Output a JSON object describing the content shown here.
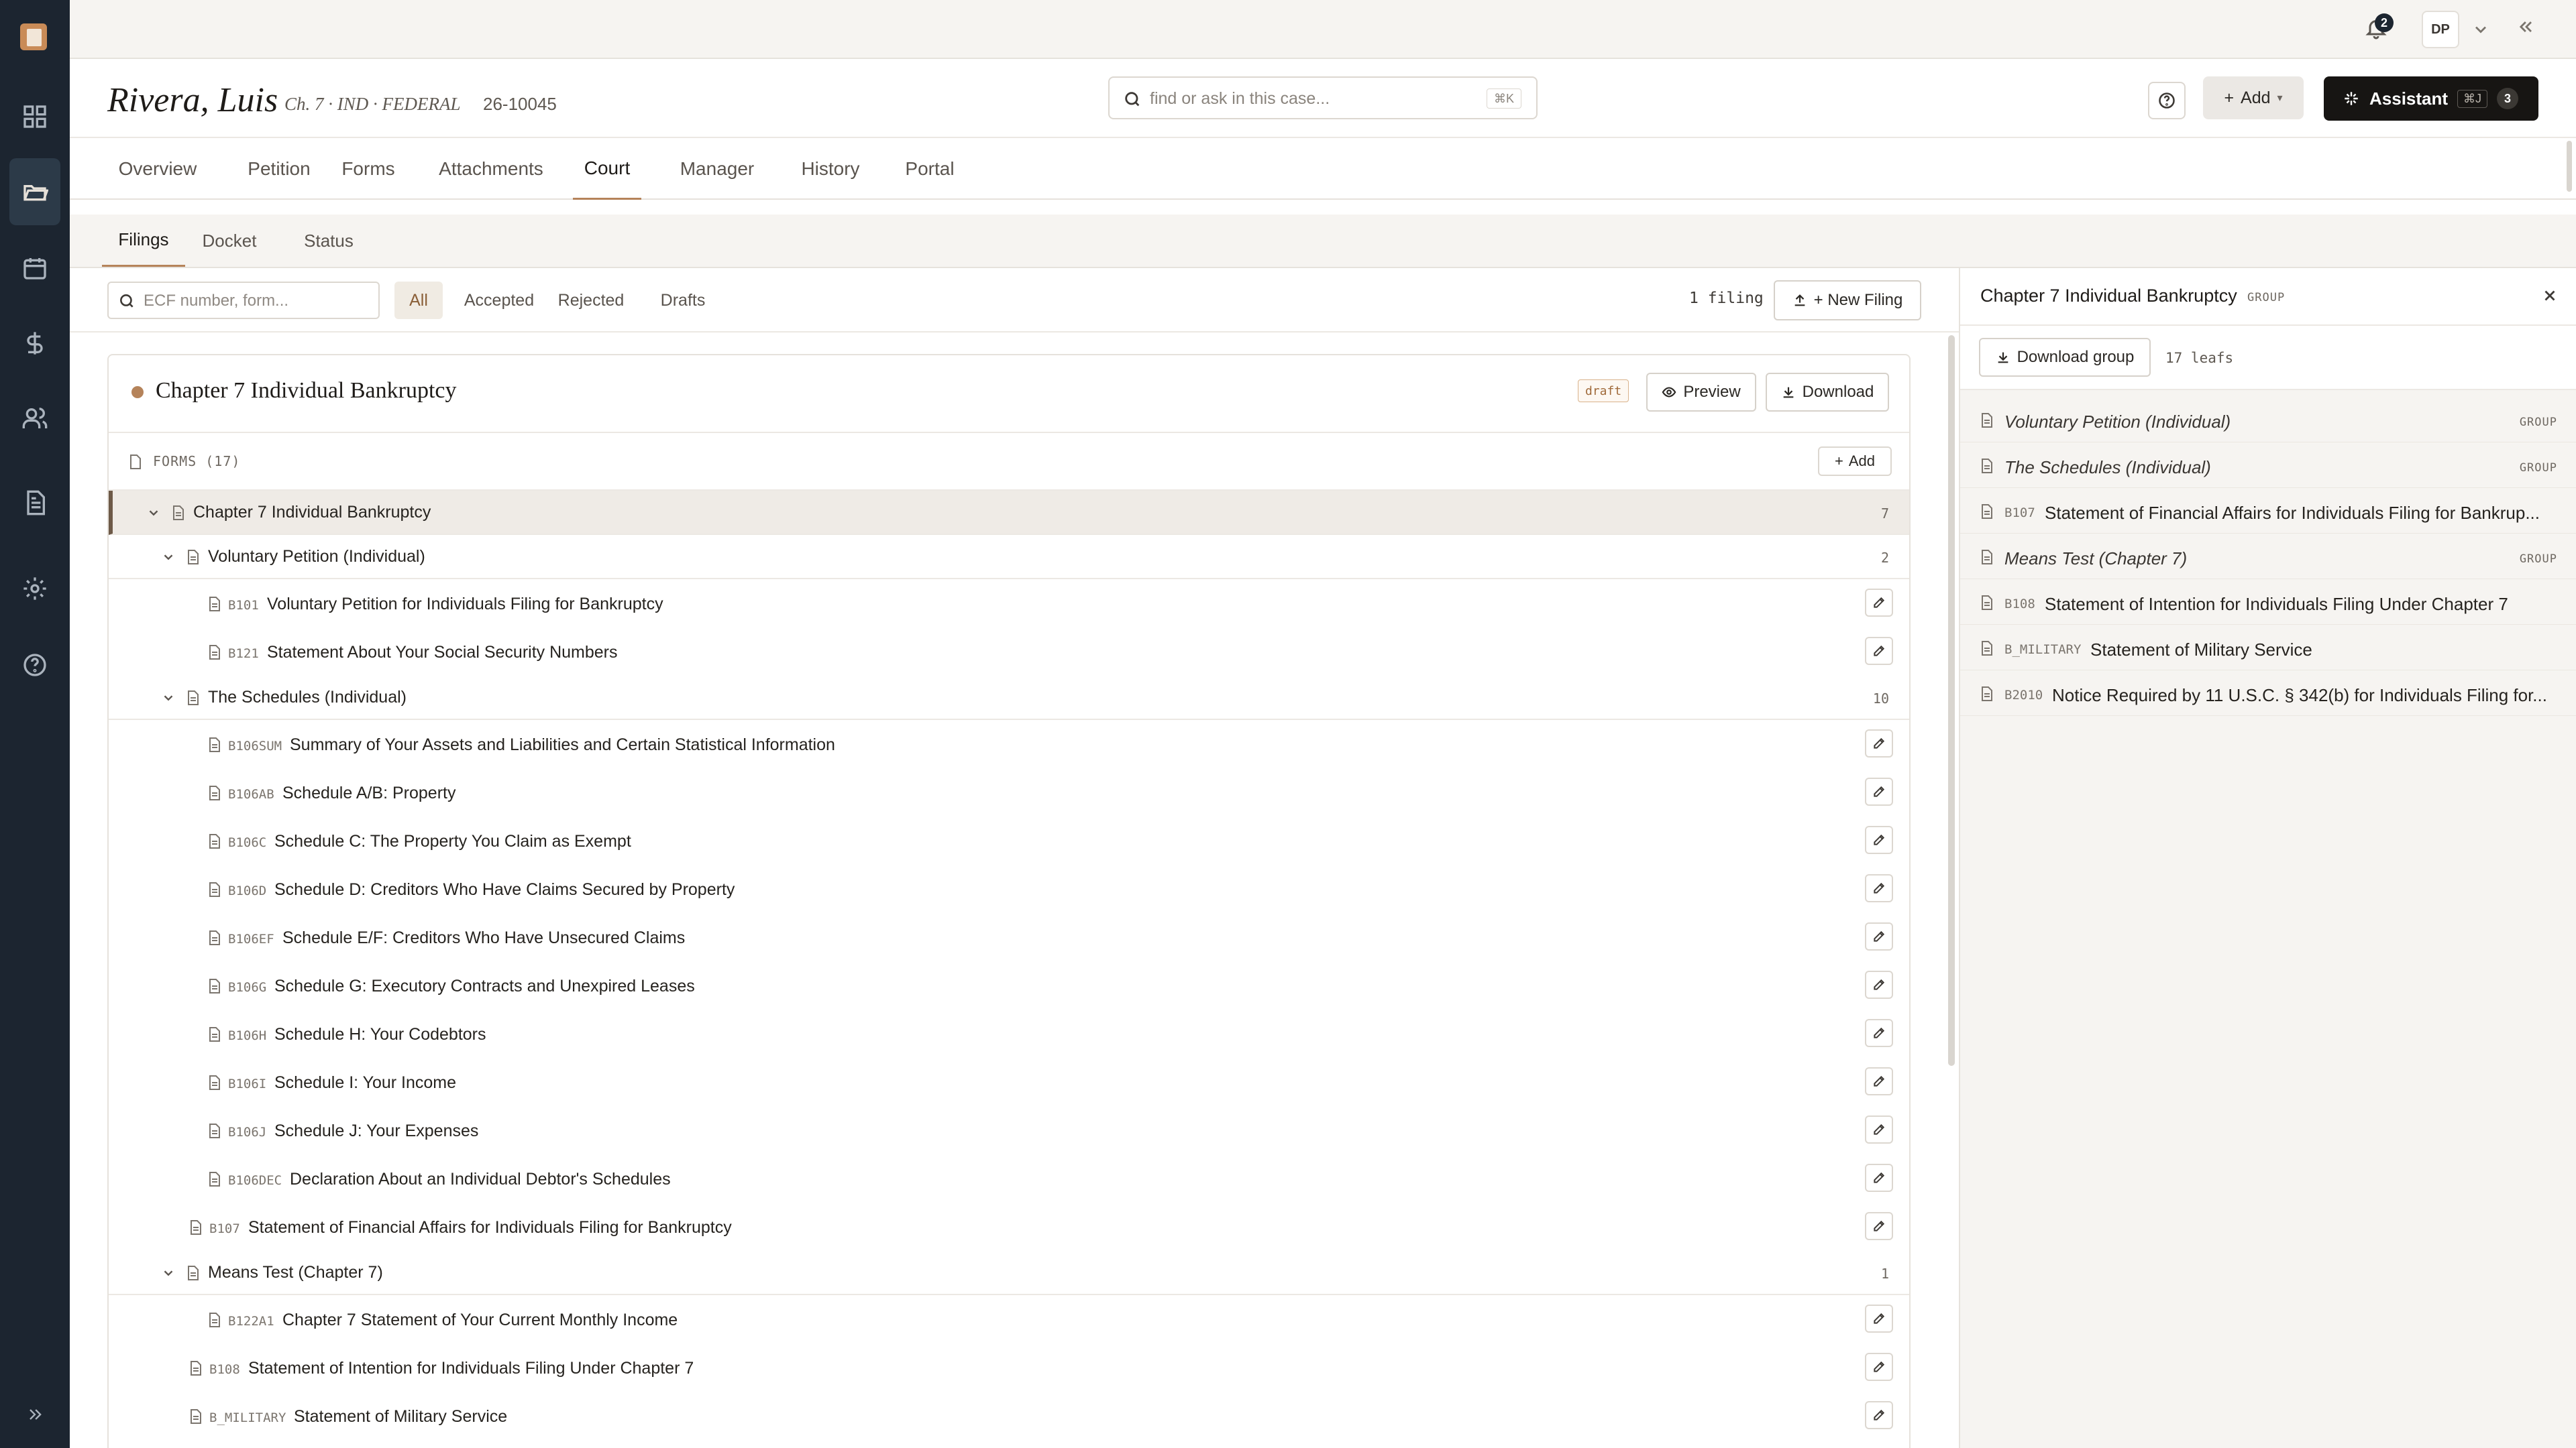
{
  "rail": {
    "items": [
      "dashboard-icon",
      "folder-icon",
      "calendar-icon",
      "dollar-icon",
      "users-icon",
      "document-icon",
      "gear-icon",
      "help-icon"
    ],
    "active": "folder-icon",
    "expand_icon": "chevrons-right-icon"
  },
  "topbar": {
    "notification_count": "2",
    "user_initials": "DP"
  },
  "case": {
    "name": "Rivera, Luis",
    "meta": "Ch. 7 · IND · FEDERAL",
    "case_number": "26-10045",
    "search_placeholder": "find or ask in this case...",
    "search_shortcut": "⌘K",
    "add_label": "Add",
    "assistant_label": "Assistant",
    "assistant_shortcut": "⌘J",
    "assistant_count": "3"
  },
  "main_tabs": [
    "Overview",
    "Petition",
    "Forms",
    "Attachments",
    "Court",
    "Manager",
    "History",
    "Portal"
  ],
  "main_tab_active": "Court",
  "sub_tabs": [
    "Filings",
    "Docket",
    "Status"
  ],
  "sub_tab_active": "Filings",
  "filters": {
    "search_placeholder": "ECF number, form...",
    "pills": [
      "All",
      "Accepted",
      "Rejected",
      "Drafts"
    ],
    "active": "All",
    "count_label": "1 filing",
    "new_filing_label": "+ New Filing"
  },
  "filing": {
    "title": "Chapter 7 Individual Bankruptcy",
    "status": "draft",
    "preview_label": "Preview",
    "download_label": "Download",
    "forms_label": "FORMS (17)",
    "add_label": "Add",
    "tree": [
      {
        "kind": "root",
        "title": "Chapter 7 Individual Bankruptcy",
        "count": "7"
      },
      {
        "kind": "group",
        "title": "Voluntary Petition (Individual)",
        "count": "2"
      },
      {
        "kind": "leaf",
        "depth": 2,
        "code": "B101",
        "title": "Voluntary Petition for Individuals Filing for Bankruptcy"
      },
      {
        "kind": "leaf",
        "depth": 2,
        "code": "B121",
        "title": "Statement About Your Social Security Numbers"
      },
      {
        "kind": "group",
        "title": "The Schedules (Individual)",
        "count": "10"
      },
      {
        "kind": "leaf",
        "depth": 2,
        "code": "B106SUM",
        "title": "Summary of Your Assets and Liabilities and Certain Statistical Information"
      },
      {
        "kind": "leaf",
        "depth": 2,
        "code": "B106AB",
        "title": "Schedule A/B: Property"
      },
      {
        "kind": "leaf",
        "depth": 2,
        "code": "B106C",
        "title": "Schedule C: The Property You Claim as Exempt"
      },
      {
        "kind": "leaf",
        "depth": 2,
        "code": "B106D",
        "title": "Schedule D: Creditors Who Have Claims Secured by Property"
      },
      {
        "kind": "leaf",
        "depth": 2,
        "code": "B106EF",
        "title": "Schedule E/F: Creditors Who Have Unsecured Claims"
      },
      {
        "kind": "leaf",
        "depth": 2,
        "code": "B106G",
        "title": "Schedule G: Executory Contracts and Unexpired Leases"
      },
      {
        "kind": "leaf",
        "depth": 2,
        "code": "B106H",
        "title": "Schedule H: Your Codebtors"
      },
      {
        "kind": "leaf",
        "depth": 2,
        "code": "B106I",
        "title": "Schedule I: Your Income"
      },
      {
        "kind": "leaf",
        "depth": 2,
        "code": "B106J",
        "title": "Schedule J: Your Expenses"
      },
      {
        "kind": "leaf",
        "depth": 2,
        "code": "B106DEC",
        "title": "Declaration About an Individual Debtor's Schedules"
      },
      {
        "kind": "leaf",
        "depth": 1,
        "code": "B107",
        "title": "Statement of Financial Affairs for Individuals Filing for Bankruptcy"
      },
      {
        "kind": "group",
        "title": "Means Test (Chapter 7)",
        "count": "1"
      },
      {
        "kind": "leaf",
        "depth": 2,
        "code": "B122A1",
        "title": "Chapter 7 Statement of Your Current Monthly Income"
      },
      {
        "kind": "leaf",
        "depth": 1,
        "code": "B108",
        "title": "Statement of Intention for Individuals Filing Under Chapter 7"
      },
      {
        "kind": "leaf",
        "depth": 1,
        "code": "B_MILITARY",
        "title": "Statement of Military Service"
      }
    ]
  },
  "panel": {
    "title": "Chapter 7 Individual Bankruptcy",
    "tag": "GROUP",
    "download_group_label": "Download group",
    "leafs_label": "17 leafs",
    "items": [
      {
        "code": "",
        "label": "Voluntary Petition (Individual)",
        "tag": "GROUP"
      },
      {
        "code": "",
        "label": "The Schedules (Individual)",
        "tag": "GROUP"
      },
      {
        "code": "B107",
        "label": "Statement of Financial Affairs for Individuals Filing for Bankrup...",
        "tag": ""
      },
      {
        "code": "",
        "label": "Means Test (Chapter 7)",
        "tag": "GROUP"
      },
      {
        "code": "B108",
        "label": "Statement of Intention for Individuals Filing Under Chapter 7",
        "tag": ""
      },
      {
        "code": "B_MILITARY",
        "label": "Statement of Military Service",
        "tag": ""
      },
      {
        "code": "B2010",
        "label": "Notice Required by 11 U.S.C. § 342(b) for Individuals Filing for...",
        "tag": ""
      }
    ]
  }
}
